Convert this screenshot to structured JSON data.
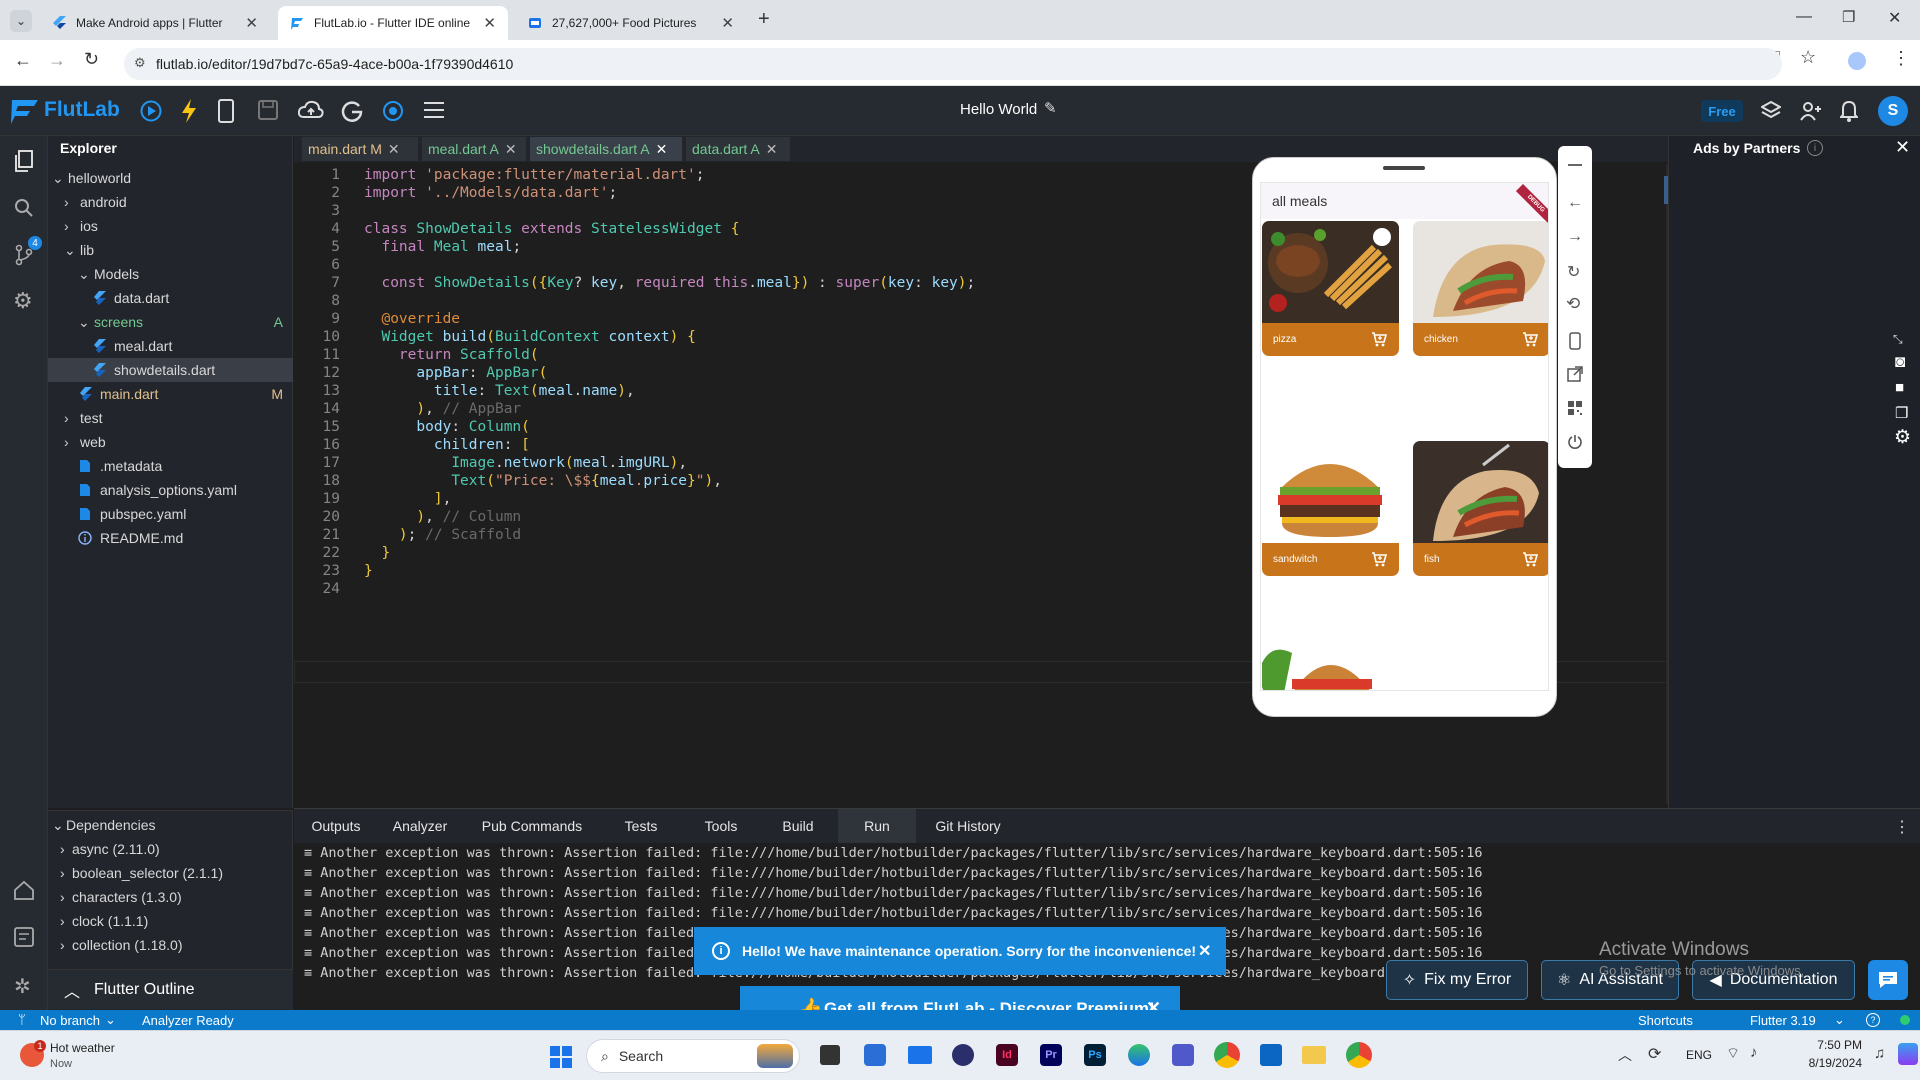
{
  "browser": {
    "tabs": [
      {
        "title": "Make Android apps | Flutter"
      },
      {
        "title": "FlutLab.io - Flutter IDE online"
      },
      {
        "title": "27,627,000+ Food Pictures"
      }
    ],
    "url": "flutlab.io/editor/19d7bd7c-65a9-4ace-b00a-1f79390d4610"
  },
  "flutlab": {
    "logo": "FlutLab",
    "project_title": "Hello World",
    "plan_badge": "Free",
    "avatar_letter": "S"
  },
  "activity": {
    "git_badge": "4"
  },
  "explorer": {
    "title": "Explorer",
    "items": [
      {
        "label": "helloworld",
        "mark": ""
      },
      {
        "label": "android",
        "mark": ""
      },
      {
        "label": "ios",
        "mark": ""
      },
      {
        "label": "lib",
        "mark": ""
      },
      {
        "label": "Models",
        "mark": ""
      },
      {
        "label": "data.dart",
        "mark": ""
      },
      {
        "label": "screens",
        "mark": "A"
      },
      {
        "label": "meal.dart",
        "mark": ""
      },
      {
        "label": "showdetails.dart",
        "mark": ""
      },
      {
        "label": "main.dart",
        "mark": "M"
      },
      {
        "label": "test",
        "mark": ""
      },
      {
        "label": "web",
        "mark": ""
      },
      {
        "label": ".metadata",
        "mark": ""
      },
      {
        "label": "analysis_options.yaml",
        "mark": ""
      },
      {
        "label": "pubspec.yaml",
        "mark": ""
      },
      {
        "label": "README.md",
        "mark": ""
      }
    ],
    "dependencies_title": "Dependencies",
    "dependencies": [
      "async (2.11.0)",
      "boolean_selector (2.1.1)",
      "characters (1.3.0)",
      "clock (1.1.1)",
      "collection (1.18.0)"
    ],
    "outline_title": "Flutter Outline"
  },
  "editor": {
    "tabs": [
      "main.dart M",
      "meal.dart A",
      "showdetails.dart A",
      "data.dart A"
    ],
    "line_numbers": [
      "1",
      "2",
      "3",
      "4",
      "5",
      "6",
      "7",
      "8",
      "9",
      "10",
      "11",
      "12",
      "13",
      "14",
      "15",
      "16",
      "17",
      "18",
      "19",
      "20",
      "21",
      "22",
      "23",
      "24"
    ],
    "lines": [
      "import 'package:flutter/material.dart';",
      "import '../Models/data.dart';",
      "",
      "class ShowDetails extends StatelessWidget {",
      "  final Meal meal;",
      "",
      "  const ShowDetails({Key? key, required this.meal}) : super(key: key);",
      "",
      "  @override",
      "  Widget build(BuildContext context) {",
      "    return Scaffold(",
      "      appBar: AppBar(",
      "        title: Text(meal.name),",
      "      ), // AppBar",
      "      body: Column(",
      "        children: [",
      "          Image.network(meal.imgURL),",
      "          Text(\"Price: \\$${meal.price}\"),",
      "        ],",
      "      ), // Column",
      "    ); // Scaffold",
      "  }",
      "}",
      ""
    ]
  },
  "ads": {
    "title": "Ads by Partners"
  },
  "phone": {
    "app_title": "all meals",
    "debug_label": "DEBUG",
    "meals": [
      {
        "name": "pizza"
      },
      {
        "name": "chicken"
      },
      {
        "name": "sandwitch"
      },
      {
        "name": "fish"
      }
    ]
  },
  "panel": {
    "tabs": [
      "Outputs",
      "Analyzer",
      "Pub Commands",
      "Tests",
      "Tools",
      "Build",
      "Run",
      "Git History"
    ],
    "active_tab": "Run",
    "log_prefix": "Another exception was thrown: Assertion failed: ",
    "log_lines": [
      "Another exception was thrown: Assertion failed: file:///home/builder/hotbuilder/packages/flutter/lib/src/services/hardware_keyboard.dart:505:16",
      "Another exception was thrown: Assertion failed: file:///home/builder/hotbuilder/packages/flutter/lib/src/services/hardware_keyboard.dart:505:16",
      "Another exception was thrown: Assertion failed: file:///home/builder/hotbuilder/packages/flutter/lib/src/services/hardware_keyboard.dart:505:16",
      "Another exception was thrown: Assertion failed: file:///home/builder/hotbuilder/packages/flutter/lib/src/services/hardware_keyboard.dart:505:16",
      "Another exception was thrown: Assertion failed: file:///home/builder/hotbuilder/packages/flutter/lib/src/services/hardware_keyboard.dart:505:16",
      "Another exception was thrown: Assertion failed: file:///home/builder/hotbuilder/packages/flutter/lib/src/services/hardware_keyboard.dart:505:16",
      "Another exception was thrown: Assertion failed: file:///home/builder/hotbuilder/packages/flutter/lib/src/services/hardware_keyboard.dart:505:16"
    ]
  },
  "buttons": {
    "fix": "Fix my Error",
    "ai": "AI Assistant",
    "docs": "Documentation"
  },
  "toasts": {
    "maintenance": "Hello! We have maintenance operation. Sorry for the inconvenience!",
    "premium": "Get all from FlutLab - Discover Premium!"
  },
  "watermark": {
    "line1": "Activate Windows",
    "line2": "Go to Settings to activate Windows."
  },
  "status": {
    "branch": "No branch",
    "analyzer": "Analyzer Ready",
    "shortcuts": "Shortcuts",
    "flutter_version": "Flutter 3.19"
  },
  "taskbar": {
    "weather_title": "Hot weather",
    "weather_sub": "Now",
    "weather_badge": "1",
    "search": "Search",
    "lang": "ENG",
    "time": "7:50 PM",
    "date": "8/19/2024"
  },
  "colors": {
    "accent": "#0b7acb",
    "meal_caption": "#c8741a",
    "flutlab_logo": "#2196f3"
  }
}
